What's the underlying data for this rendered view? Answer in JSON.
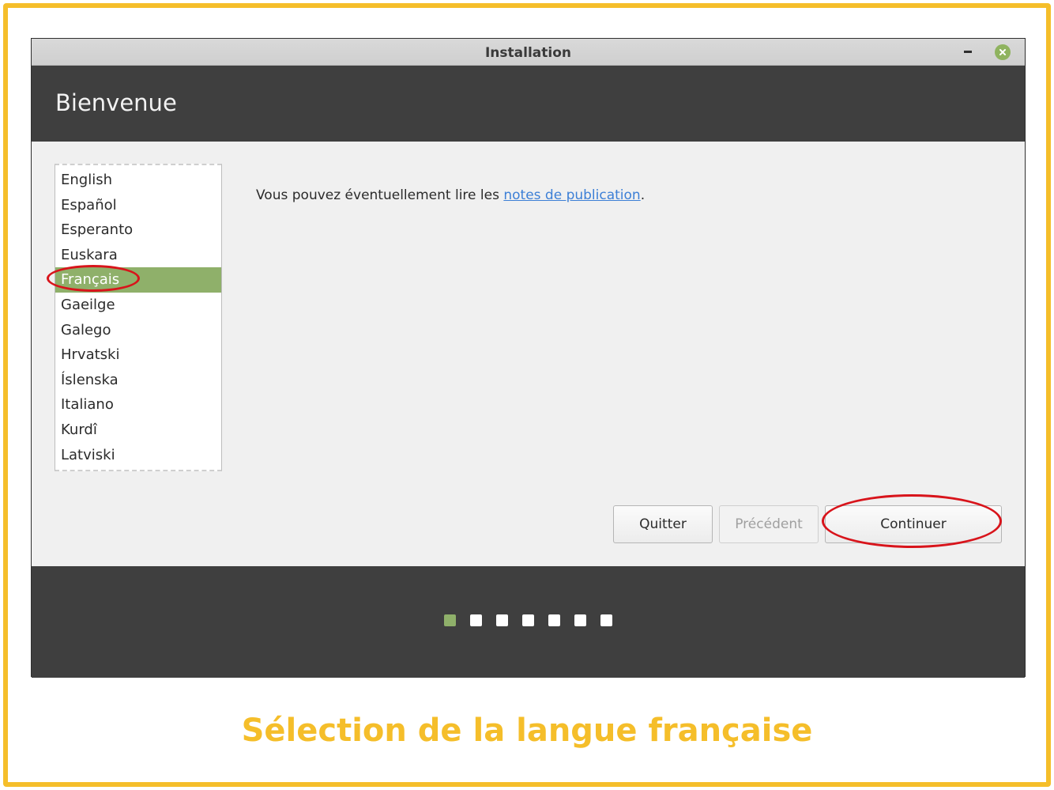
{
  "window": {
    "title": "Installation"
  },
  "header": {
    "title": "Bienvenue"
  },
  "languages": {
    "items": [
      {
        "label": "English"
      },
      {
        "label": "Español"
      },
      {
        "label": "Esperanto"
      },
      {
        "label": "Euskara"
      },
      {
        "label": "Français"
      },
      {
        "label": "Gaeilge"
      },
      {
        "label": "Galego"
      },
      {
        "label": "Hrvatski"
      },
      {
        "label": "Íslenska"
      },
      {
        "label": "Italiano"
      },
      {
        "label": "Kurdî"
      },
      {
        "label": "Latviski"
      }
    ],
    "selected": "Français"
  },
  "notes": {
    "text": "Vous pouvez éventuellement lire les ",
    "link": "notes de publication",
    "suffix": "."
  },
  "buttons": {
    "quit": "Quitter",
    "previous": "Précédent",
    "continue": "Continuer"
  },
  "progress": {
    "total_steps": 7,
    "current_step": 1
  },
  "colors": {
    "accent": "#8fb06a",
    "frame": "#f5be2a",
    "highlight": "#d8141b"
  },
  "caption": "Sélection de la langue française"
}
